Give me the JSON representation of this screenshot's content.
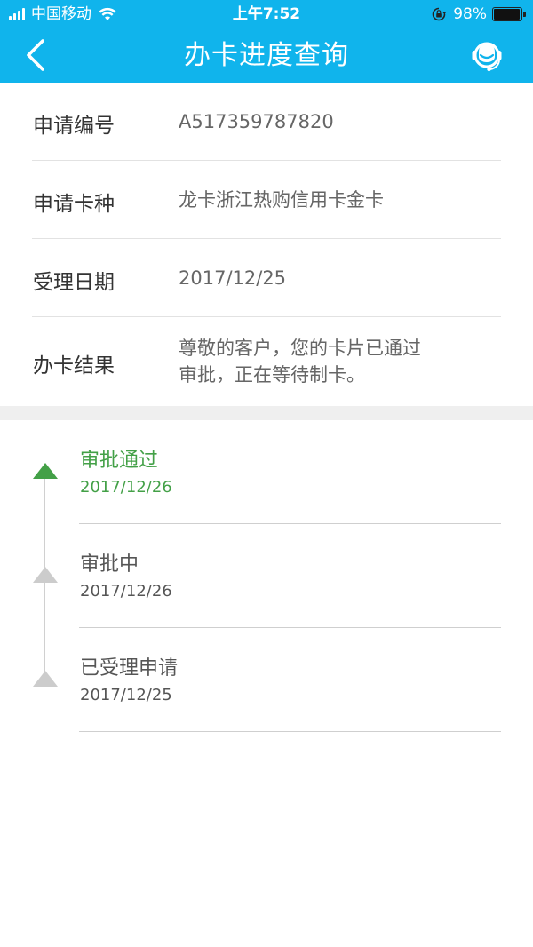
{
  "status_bar": {
    "carrier": "中国移动",
    "time": "上午7:52",
    "battery_percent": "98%",
    "battery_level": 0.98
  },
  "nav": {
    "title": "办卡进度查询",
    "back_icon": "chevron-left-icon",
    "service_icon": "customer-service-icon"
  },
  "info": {
    "rows": [
      {
        "label": "申请编号",
        "value": "A517359787820"
      },
      {
        "label": "申请卡种",
        "value": "龙卡浙江热购信用卡金卡"
      },
      {
        "label": "受理日期",
        "value": "2017/12/25"
      },
      {
        "label": "办卡结果",
        "value_line1": "尊敬的客户，您的卡片已通过",
        "value_line2": "审批，正在等待制卡。"
      }
    ]
  },
  "timeline": {
    "active_color": "#43a047",
    "inactive_color": "#cccccc",
    "items": [
      {
        "title": "审批通过",
        "date": "2017/12/26",
        "active": true
      },
      {
        "title": "审批中",
        "date": "2017/12/26",
        "active": false
      },
      {
        "title": "已受理申请",
        "date": "2017/12/25",
        "active": false
      }
    ]
  },
  "colors": {
    "header_bg": "#10b4ec"
  }
}
